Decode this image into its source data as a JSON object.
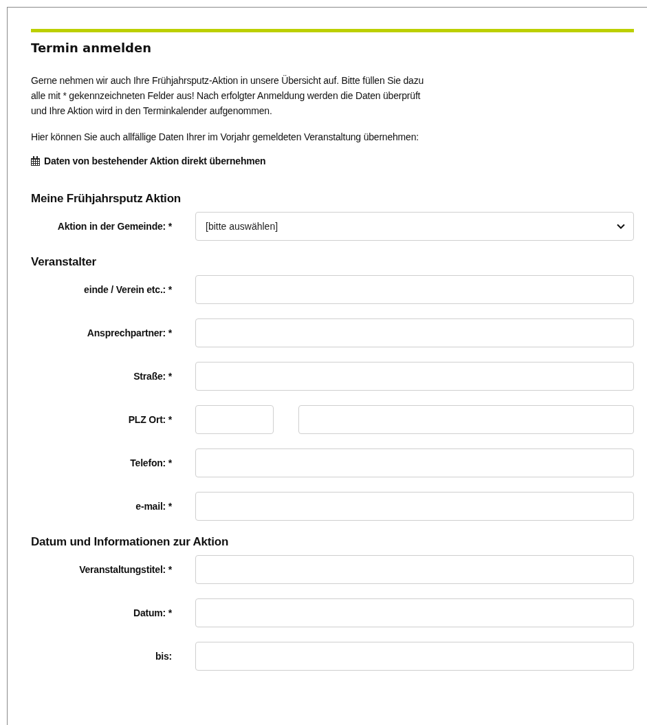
{
  "title": "Termin anmelden",
  "intro_lines": [
    "Gerne nehmen wir auch Ihre Frühjahrsputz-Aktion in unsere Übersicht auf. Bitte füllen Sie dazu",
    "alle mit * gekennzeichneten Felder aus! Nach erfolgter Anmeldung werden die Daten überprüft",
    "und Ihre Aktion wird in den Terminkalender aufgenommen."
  ],
  "hint": "Hier können Sie auch allfällige Daten Ihrer im Vorjahr gemeldeten Veranstaltung übernehmen:",
  "import_link": "Daten von bestehender Aktion direkt übernehmen",
  "sections": [
    {
      "heading": "Meine Frühjahrsputz Aktion",
      "rows": [
        {
          "kind": "select",
          "label": "Aktion in der Gemeinde: *",
          "value": "[bitte auswählen]"
        }
      ]
    },
    {
      "heading": "Veranstalter",
      "rows": [
        {
          "kind": "text",
          "label": "einde / Verein etc.: *"
        },
        {
          "kind": "text",
          "label": "Ansprechpartner: *"
        },
        {
          "kind": "text",
          "label": "Straße: *"
        },
        {
          "kind": "split",
          "label": "PLZ Ort: *"
        },
        {
          "kind": "text",
          "label": "Telefon: *"
        },
        {
          "kind": "text",
          "label": "e-mail: *"
        }
      ]
    },
    {
      "heading": "Datum und Informationen zur Aktion",
      "rows": [
        {
          "kind": "text",
          "label": "Veranstaltungstitel: *"
        },
        {
          "kind": "text",
          "label": "Datum: *"
        },
        {
          "kind": "text",
          "label": "bis:"
        }
      ]
    }
  ]
}
